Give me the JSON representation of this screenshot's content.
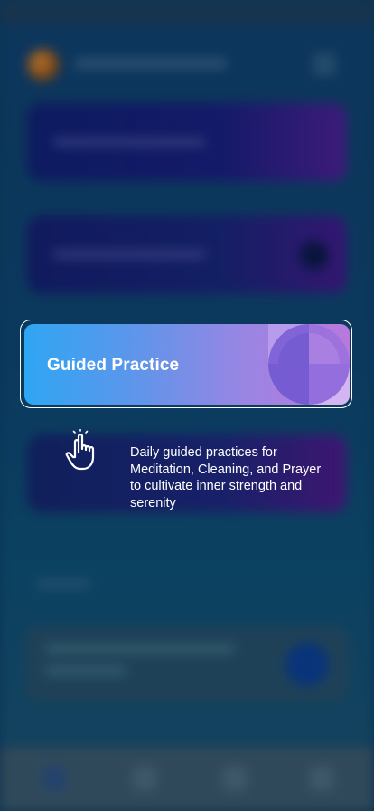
{
  "coachmark": {
    "card_title": "Guided Practice",
    "description": "Daily guided practices for Meditation, Cleaning, and Prayer to cultivate inner strength and serenity",
    "pointer_icon": "hand-pointer-icon",
    "card_icon": "pinwheel-icon"
  },
  "colors": {
    "card_gradient_start": "#2fa6f3",
    "card_gradient_end": "#b879dc",
    "highlight_border": "#ffffff",
    "background": "#0d3a5c"
  }
}
